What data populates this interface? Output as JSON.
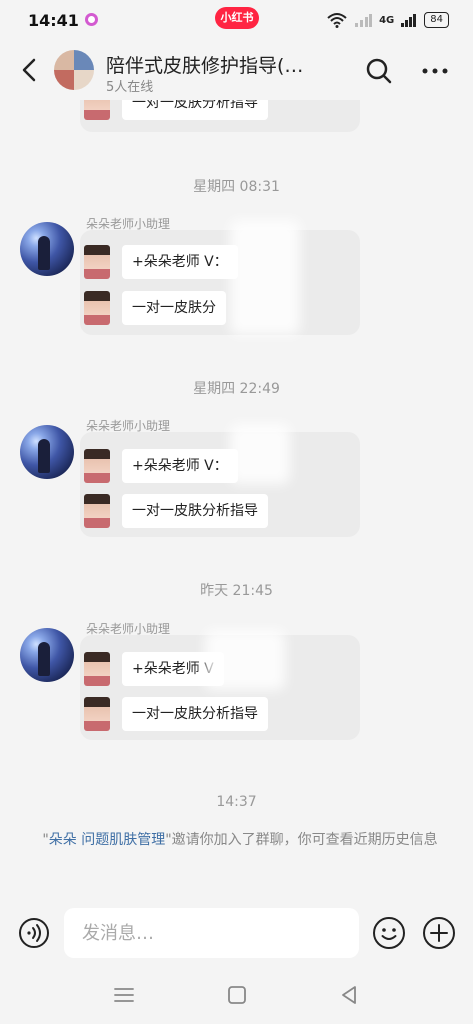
{
  "status_bar": {
    "time": "14:41",
    "app_badge": "小红书",
    "network": "4G",
    "battery": "84"
  },
  "header": {
    "title": "陪伴式皮肤修护指导(…",
    "subtitle": "5人在线"
  },
  "chat": {
    "top_partial_card": "一对一皮肤分析指导",
    "groups": [
      {
        "time": "星期四 08:31",
        "sender": "朵朵老师小助理",
        "cards": [
          "+朵朵老师 V：",
          "一对一皮肤分"
        ]
      },
      {
        "time": "星期四 22:49",
        "sender": "朵朵老师小助理",
        "cards": [
          "+朵朵老师 V：",
          "一对一皮肤分析指导"
        ]
      },
      {
        "time": "昨天 21:45",
        "sender": "朵朵老师小助理",
        "cards": [
          "+朵朵老师 V",
          "一对一皮肤分析指导"
        ]
      }
    ],
    "last_time": "14:37",
    "invite": {
      "quote_open": "\"",
      "inviter": "朵朵 问题肌肤管理",
      "quote_close": "\"",
      "text": "邀请你加入了群聊，你可查看近期历史信息"
    }
  },
  "input": {
    "placeholder": "发消息…"
  },
  "icons": {
    "back": "chevron-left-icon",
    "search": "search-icon",
    "more": "more-dots-icon",
    "voice": "voice-icon",
    "emoji": "emoji-icon",
    "plus": "plus-icon"
  },
  "colors": {
    "brand": "#ff2442",
    "link": "#3f6fa5",
    "background": "#f4f4f4"
  }
}
